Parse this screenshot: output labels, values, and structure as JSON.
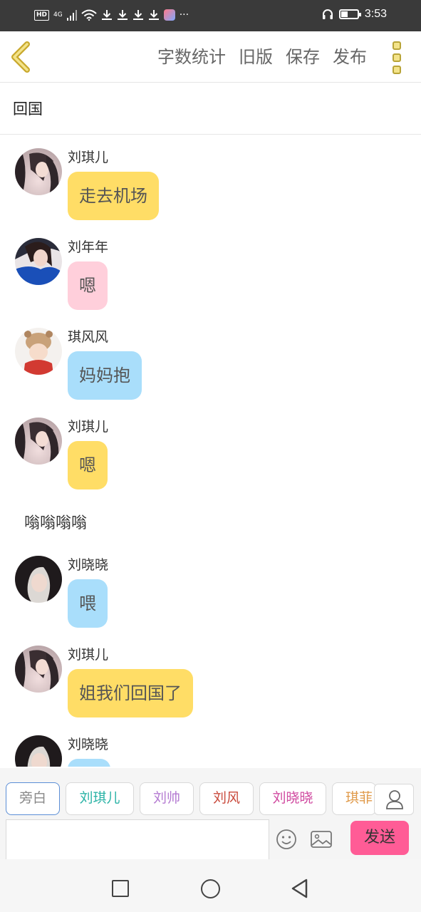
{
  "status_bar": {
    "hd": "HD",
    "network": "4G",
    "time": "3:53",
    "icons": [
      "hd-icon",
      "signal-icon",
      "wifi-icon",
      "download-icon",
      "download-icon",
      "download-icon",
      "download-icon",
      "app-icon",
      "more-dots-icon",
      "headset-icon",
      "battery-icon"
    ],
    "overflow": "···"
  },
  "toolbar": {
    "actions": [
      "字数统计",
      "旧版",
      "保存",
      "发布"
    ],
    "accent_color": "#f3e38a"
  },
  "title": "回国",
  "chat": {
    "items": [
      {
        "kind": "message",
        "name": "刘琪儿",
        "text": "走去机场",
        "bubble": "yellow",
        "avatar": "avatar-liuqier"
      },
      {
        "kind": "message",
        "name": "刘年年",
        "text": "嗯",
        "bubble": "pink",
        "avatar": "avatar-liunian"
      },
      {
        "kind": "message",
        "name": "琪风风",
        "text": "妈妈抱",
        "bubble": "blue",
        "avatar": "avatar-qifengfeng"
      },
      {
        "kind": "message",
        "name": "刘琪儿",
        "text": "嗯",
        "bubble": "yellow",
        "avatar": "avatar-liuqier"
      },
      {
        "kind": "narration",
        "text": "嗡嗡嗡嗡"
      },
      {
        "kind": "message",
        "name": "刘晓晓",
        "text": "喂",
        "bubble": "blue",
        "avatar": "avatar-liuxiaoxiao"
      },
      {
        "kind": "message",
        "name": "刘琪儿",
        "text": "姐我们回国了",
        "bubble": "yellow",
        "avatar": "avatar-liuqier"
      },
      {
        "kind": "message",
        "name": "刘晓晓",
        "text": "",
        "bubble": "blue",
        "avatar": "avatar-liuxiaoxiao"
      }
    ],
    "bubble_colors": {
      "yellow": "#ffdd66",
      "pink": "#ffcfdb",
      "blue": "#a9defb"
    }
  },
  "roles": [
    {
      "label": "旁白",
      "color": "#888888",
      "active": true
    },
    {
      "label": "刘琪儿",
      "color": "#2bb3a6",
      "active": false
    },
    {
      "label": "刘帅",
      "color": "#b47ad1",
      "active": false
    },
    {
      "label": "刘风",
      "color": "#c94a3c",
      "active": false
    },
    {
      "label": "刘晓晓",
      "color": "#d04aa0",
      "active": false
    },
    {
      "label": "琪菲",
      "color": "#e09a4a",
      "active": false
    }
  ],
  "input": {
    "value": "",
    "placeholder": "",
    "send_label": "发送",
    "send_color": "#ff5c96"
  },
  "nav": {
    "icons": [
      "recent-apps-icon",
      "home-icon",
      "back-icon"
    ]
  }
}
